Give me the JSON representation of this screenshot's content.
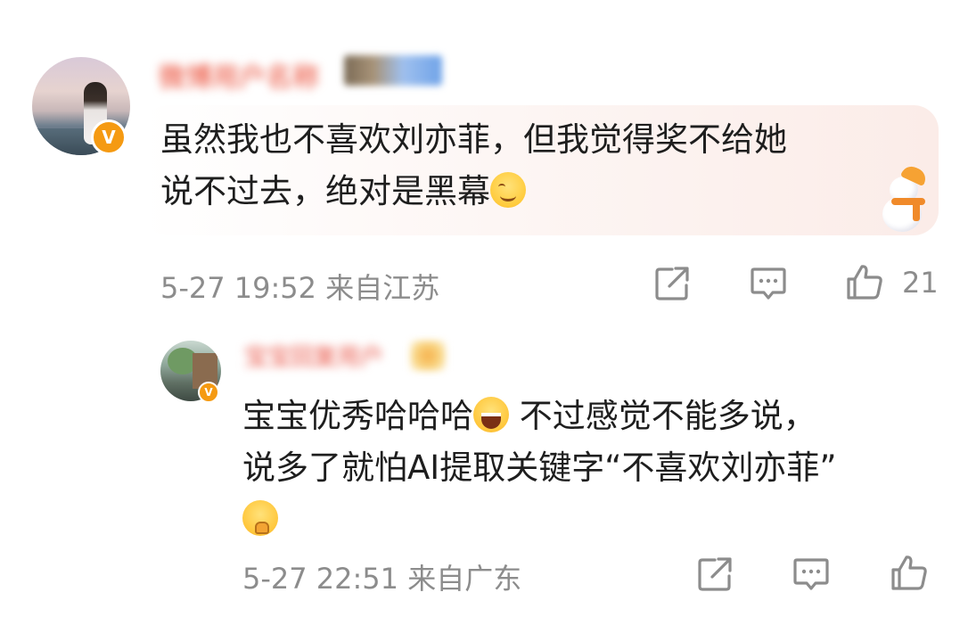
{
  "comments": [
    {
      "username": "微博用户名称",
      "text_lines": [
        "虽然我也不喜欢刘亦菲，但我觉得奖不给她",
        "说不过去，绝对是黑幕"
      ],
      "emoji_inline": "smiling-face-emoji",
      "date": "5-27 19:52",
      "location": "来自江苏",
      "likes": "21"
    },
    {
      "username": "宝宝回复用户",
      "text_line1": "宝宝优秀哈哈哈",
      "text_line1_tail": " 不过感觉不能多说，",
      "text_line2": "说多了就怕AI提取关键字“不喜欢刘亦菲”",
      "emoji_inline": [
        "laughing-face-emoji",
        "thinking-face-emoji"
      ],
      "date": "5-27 22:51",
      "location": "来自广东",
      "likes": ""
    }
  ],
  "colors": {
    "meta_gray": "#8c8c8c",
    "text": "#1e1e1e",
    "verified_badge": "#f59a12",
    "bubble_tint": "#fbece8"
  },
  "icons": [
    "share-icon",
    "comment-icon",
    "like-icon",
    "verified-badge-icon",
    "snowman-decoration-icon"
  ]
}
